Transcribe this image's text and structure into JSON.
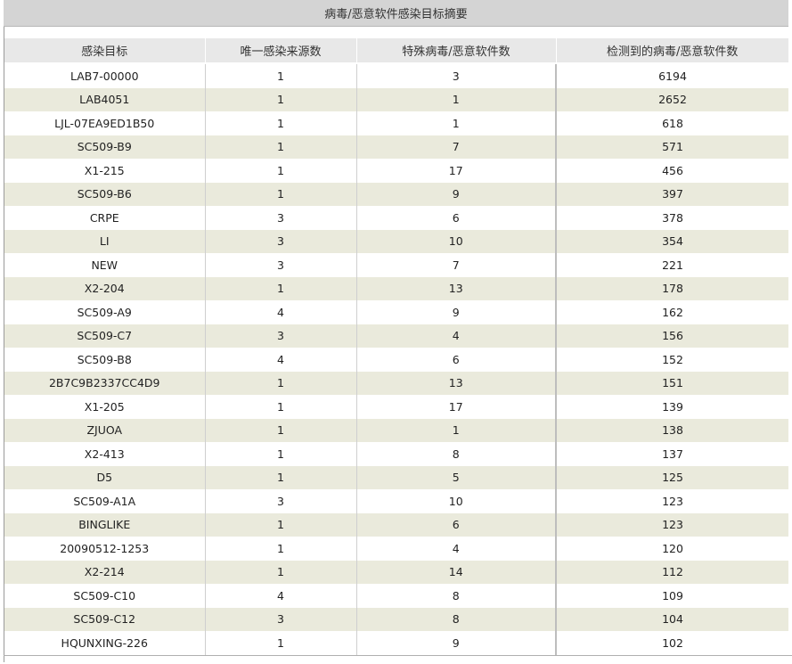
{
  "title": "病毒/恶意软件感染目标摘要",
  "colors": {
    "title_bg": "#d4d4d4",
    "header_bg": "#e8e8e8",
    "alt_row_bg": "#eaeadc"
  },
  "columns": [
    "感染目标",
    "唯一感染来源数",
    "特殊病毒/恶意软件数",
    "检测到的病毒/恶意软件数"
  ],
  "rows": [
    [
      "LAB7-00000",
      "1",
      "3",
      "6194"
    ],
    [
      "LAB4051",
      "1",
      "1",
      "2652"
    ],
    [
      "LJL-07EA9ED1B50",
      "1",
      "1",
      "618"
    ],
    [
      "SC509-B9",
      "1",
      "7",
      "571"
    ],
    [
      "X1-215",
      "1",
      "17",
      "456"
    ],
    [
      "SC509-B6",
      "1",
      "9",
      "397"
    ],
    [
      "CRPE",
      "3",
      "6",
      "378"
    ],
    [
      "LI",
      "3",
      "10",
      "354"
    ],
    [
      "NEW",
      "3",
      "7",
      "221"
    ],
    [
      "X2-204",
      "1",
      "13",
      "178"
    ],
    [
      "SC509-A9",
      "4",
      "9",
      "162"
    ],
    [
      "SC509-C7",
      "3",
      "4",
      "156"
    ],
    [
      "SC509-B8",
      "4",
      "6",
      "152"
    ],
    [
      "2B7C9B2337CC4D9",
      "1",
      "13",
      "151"
    ],
    [
      "X1-205",
      "1",
      "17",
      "139"
    ],
    [
      "ZJUOA",
      "1",
      "1",
      "138"
    ],
    [
      "X2-413",
      "1",
      "8",
      "137"
    ],
    [
      "D5",
      "1",
      "5",
      "125"
    ],
    [
      "SC509-A1A",
      "3",
      "10",
      "123"
    ],
    [
      "BINGLIKE",
      "1",
      "6",
      "123"
    ],
    [
      "20090512-1253",
      "1",
      "4",
      "120"
    ],
    [
      "X2-214",
      "1",
      "14",
      "112"
    ],
    [
      "SC509-C10",
      "4",
      "8",
      "109"
    ],
    [
      "SC509-C12",
      "3",
      "8",
      "104"
    ],
    [
      "HQUNXING-226",
      "1",
      "9",
      "102"
    ]
  ]
}
